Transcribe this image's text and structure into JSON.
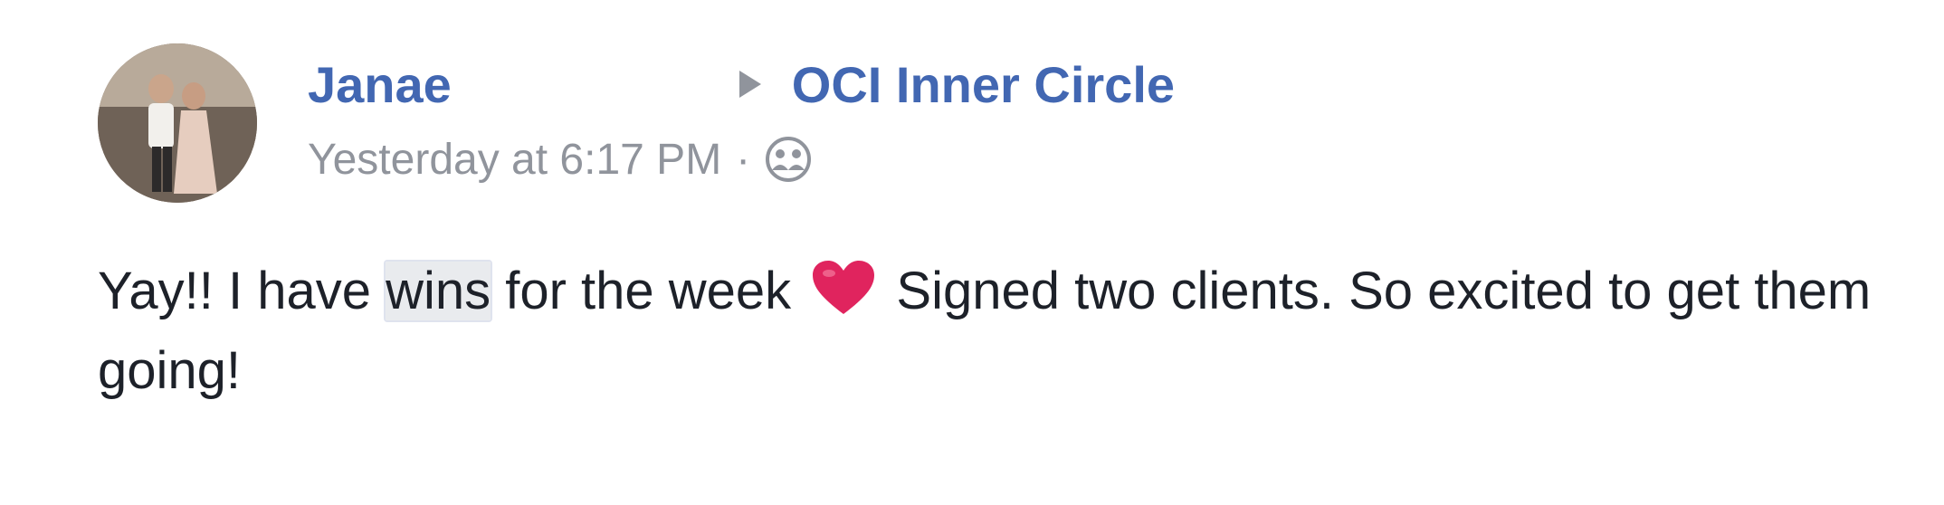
{
  "post": {
    "author": "Janae",
    "group": "OCI Inner Circle",
    "timestamp": "Yesterday at 6:17 PM",
    "separator": "·",
    "audience_icon": "group-audience-icon",
    "message": {
      "part1": "Yay!! I have ",
      "highlight": "wins",
      "part2": " for the week ",
      "emoji": "heart-emoji",
      "part3": " Signed two clients. So excited to get them going!"
    }
  },
  "colors": {
    "link": "#4267b2",
    "meta": "#90949c",
    "text": "#1d2129",
    "heart": "#e0245e"
  }
}
